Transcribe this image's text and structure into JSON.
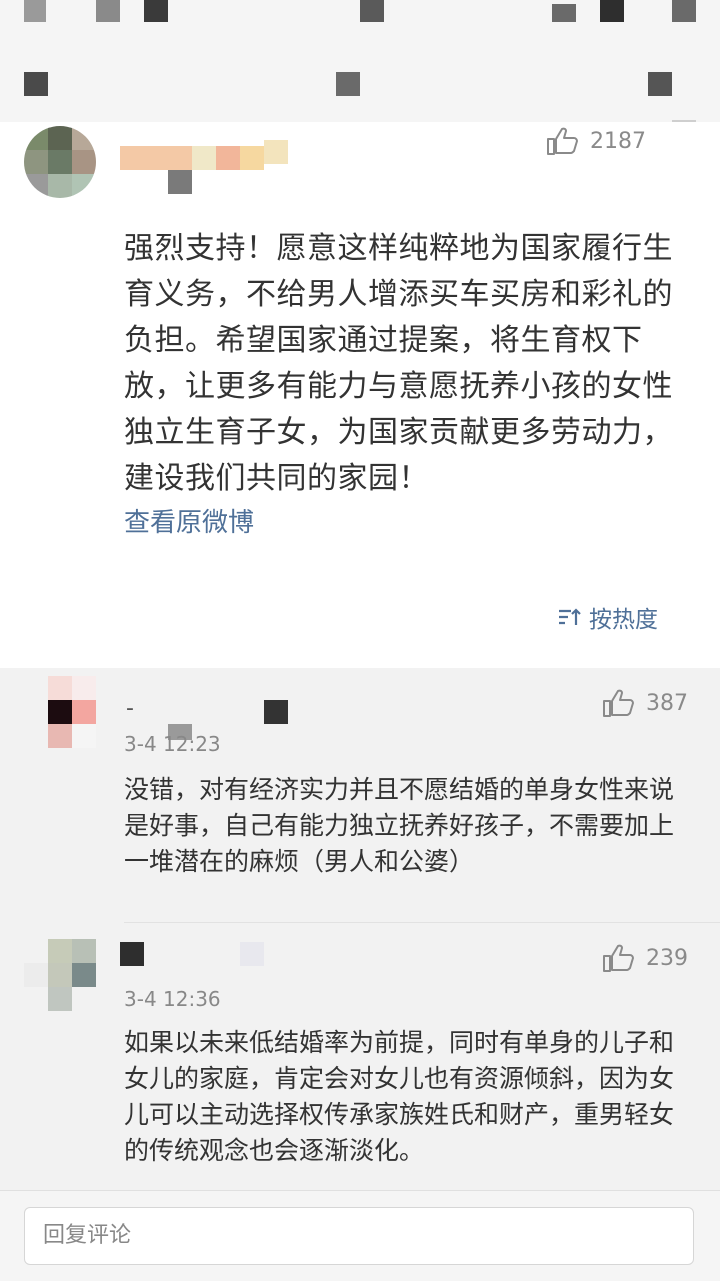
{
  "main_comment": {
    "likes": "2187",
    "text": "强烈支持！愿意这样纯粹地为国家履行生育义务，不给男人增添买车买房和彩礼的负担。希望国家通过提案，将生育权下放，让更多有能力与意愿抚养小孩的女性独立生育子女，为国家贡献更多劳动力，建设我们共同的家园！",
    "view_original": "查看原微博",
    "sort_label": "按热度",
    "icons": {
      "like": "thumbs-up-icon",
      "sort": "sort-icon"
    }
  },
  "replies": [
    {
      "username": "-",
      "time": "3-4 12:23",
      "likes": "387",
      "text": "没错，对有经济实力并且不愿结婚的单身女性来说是好事，自己有能力独立抚养好孩子，不需要加上一堆潜在的麻烦（男人和公婆）"
    },
    {
      "username": "",
      "time": "3-4 12:36",
      "likes": "239",
      "text": "如果以未来低结婚率为前提，同时有单身的儿子和女儿的家庭，肯定会对女儿也有资源倾斜，因为女儿可以主动选择权传承家族姓氏和财产，重男轻女的传统观念也会逐渐淡化。"
    }
  ],
  "reply_input": {
    "placeholder": "回复评论"
  }
}
